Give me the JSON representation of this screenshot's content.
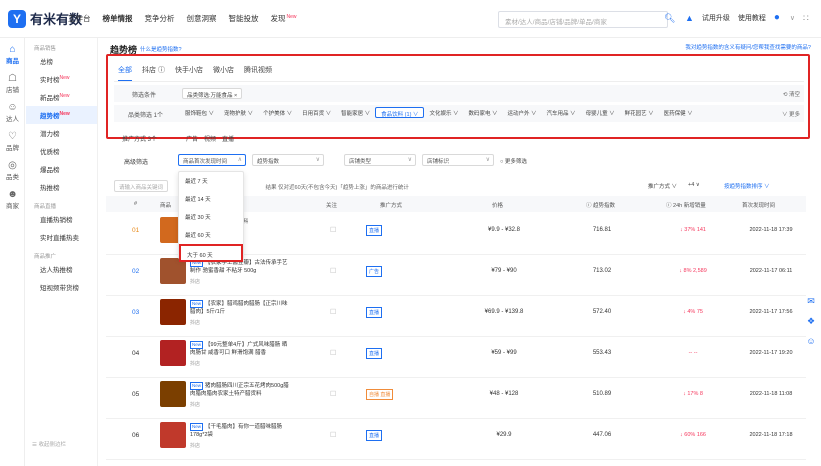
{
  "app": {
    "logo_text": "有米有数"
  },
  "topnav": [
    {
      "label": "工作台"
    },
    {
      "label": "榜单情报",
      "active": true
    },
    {
      "label": "竞争分析"
    },
    {
      "label": "创意洞察"
    },
    {
      "label": "智能投放"
    },
    {
      "label": "发现",
      "badge": "New"
    }
  ],
  "search": {
    "placeholder": "素材/达人/商品/店铺/品牌/单品/商家"
  },
  "top_right": {
    "trial": "试用升级",
    "tutorial": "使用教程"
  },
  "sidebar": [
    {
      "label": "商品",
      "icon": "goods-icon",
      "active": true
    },
    {
      "label": "店铺",
      "icon": "shop-icon"
    },
    {
      "label": "达人",
      "icon": "person-icon"
    },
    {
      "label": "品牌",
      "icon": "brand-icon"
    },
    {
      "label": "品类",
      "icon": "category-icon"
    },
    {
      "label": "商家",
      "icon": "merchant-icon"
    }
  ],
  "subnav": {
    "group1": "商品销售",
    "items1": [
      {
        "label": "总榜"
      },
      {
        "label": "实时榜",
        "badge": "New"
      },
      {
        "label": "新品榜",
        "badge": "New"
      },
      {
        "label": "趋势榜",
        "badge": "New",
        "active": true
      },
      {
        "label": "潜力榜"
      },
      {
        "label": "优质榜"
      },
      {
        "label": "爆品榜"
      },
      {
        "label": "热推榜"
      }
    ],
    "group2": "商品直播",
    "items2": [
      {
        "label": "直播热销榜"
      },
      {
        "label": "实时直播热卖"
      }
    ],
    "group3": "商品推广",
    "items3": [
      {
        "label": "达人热推榜"
      },
      {
        "label": "短视频带货榜"
      }
    ],
    "footer": "收起侧边栏"
  },
  "page": {
    "title": "趋势榜",
    "title_hint": "什么是趋势指数?",
    "top_link": "我对趋势指数的含义有疑问/您帮我查找需要的商品?"
  },
  "platform_tabs": [
    {
      "label": "全部",
      "active": true
    },
    {
      "label": "抖店 ⓘ"
    },
    {
      "label": "快手小店"
    },
    {
      "label": "微小店"
    },
    {
      "label": "腾讯视频"
    }
  ],
  "filters": {
    "condition_label": "筛选条件",
    "condition_tag": "品类筛选:万能食品 ×",
    "clear": "⟲ 清空",
    "category_label": "品类筛选 1个",
    "categories": [
      {
        "label": "服饰鞋包 ∨"
      },
      {
        "label": "宠物护肤 ∨"
      },
      {
        "label": "个护美体 ∨"
      },
      {
        "label": "日用百货 ∨"
      },
      {
        "label": "智能家居 ∨"
      },
      {
        "label": "食品饮料 (1) ∨",
        "selected": true
      },
      {
        "label": "文化娱乐 ∨"
      },
      {
        "label": "数码家电 ∨"
      },
      {
        "label": "运动户外 ∨"
      },
      {
        "label": "汽车用品 ∨"
      },
      {
        "label": "母婴儿童 ∨"
      },
      {
        "label": "鲜花园艺 ∨"
      },
      {
        "label": "医药保健 ∨"
      }
    ],
    "more": "∨ 更多",
    "promo_label": "推广方式 3个",
    "promo_options": [
      "广告",
      "视频",
      "直播"
    ],
    "advanced_label": "高级筛选",
    "select_first_time": "商品首次发现时间",
    "select_trend": "趋势指数",
    "select_shop_type": "店铺类型",
    "select_shop_tag": "店铺标识",
    "other_filter": "○ 更多筛选",
    "dropdown_options": [
      "最近 7 天",
      "最近 14 天",
      "最近 30 天",
      "最近 60 天",
      "大于 60 天"
    ]
  },
  "list_bar": {
    "search_placeholder": "请输入商品关键词",
    "note": "结果    仅对近60天(不包含今天)「趋势上涨」的商品进行统计",
    "sort_type": "推广方式 ∨",
    "sort_value": "+4 ∨",
    "sort_order": "按趋势指数排序 ∨"
  },
  "table": {
    "headers": [
      "#",
      "商品",
      "关注",
      "推广方式",
      "价格",
      "ⓘ 趋势指数",
      "ⓘ 24h 新增销量",
      "首次发现时间"
    ],
    "rows": [
      {
        "rank": "01",
        "rank_color": "orange",
        "new": false,
        "name": "...粗水笋248g*袋装 ...料",
        "shop": "",
        "promo": "直播",
        "promo_color": "blue",
        "price": "¥9.9 - ¥32.8",
        "index": "716.81",
        "gmv": "↓ 37% 141",
        "first": "2022-11-18 17:39",
        "img_color": "#d2691e"
      },
      {
        "rank": "02",
        "rank_color": "blue",
        "new": true,
        "name": "【农家手工酱豆瓣】古法传承手艺制作 驰蜜香甜 不粘牙 500g",
        "shop": "抖店",
        "promo": "广告",
        "promo_color": "blue",
        "price": "¥79 - ¥90",
        "index": "713.02",
        "gmv": "↓ 8% 2,589",
        "first": "2022-11-17 06:11",
        "img_color": "#a0522d"
      },
      {
        "rank": "03",
        "rank_color": "blue",
        "new": true,
        "name": "【农家】腊鸡腊肉腊肠【正宗川味腊肉】5斤/1斤",
        "shop": "抖店",
        "promo": "直播",
        "promo_color": "blue",
        "price": "¥69.9 - ¥139.8",
        "index": "572.40",
        "gmv": "↓ 4% 75",
        "first": "2022-11-17 17:56",
        "img_color": "#8b2500"
      },
      {
        "rank": "04",
        "rank_color": "black",
        "new": true,
        "name": "【99元整单4斤】广式风味腊肠 晒肉肠甘 咸香可口 鲜滑饱满 腊香",
        "shop": "抖店",
        "promo": "直播",
        "promo_color": "blue",
        "price": "¥59 - ¥99",
        "index": "553.43",
        "gmv": "-- --",
        "first": "2022-11-17 19:20",
        "img_color": "#b22222"
      },
      {
        "rank": "05",
        "rank_color": "black",
        "new": true,
        "name": "猪肉腊肠四川正宗五花烤肉500g腊肉腊肉腊肉农家土特产腊货料",
        "shop": "抖店",
        "promo": "自播 直播",
        "promo_color": "orange",
        "price": "¥48 - ¥128",
        "index": "510.89",
        "gmv": "↓ 17% 8",
        "first": "2022-11-18 11:08",
        "img_color": "#7b3f00"
      },
      {
        "rank": "06",
        "rank_color": "black",
        "new": true,
        "name": "【干毛腊肉】有你一道腊味腊肠178g*2袋",
        "shop": "抖店",
        "promo": "直播",
        "promo_color": "blue",
        "price": "¥29.9",
        "index": "447.06",
        "gmv": "↓ 60% 166",
        "first": "2022-11-18 17:18",
        "img_color": "#c0392b"
      }
    ]
  },
  "colors": {
    "accent": "#1e6ff1",
    "highlight": "#e02424",
    "badge": "#f5365c"
  }
}
